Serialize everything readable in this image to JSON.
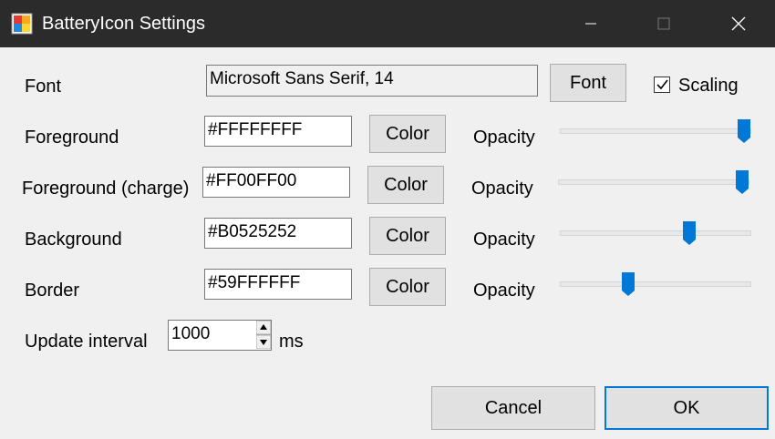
{
  "window": {
    "title": "BatteryIcon Settings"
  },
  "font_row": {
    "label": "Font",
    "value": "Microsoft Sans Serif, 14",
    "button": "Font",
    "scaling_label": "Scaling",
    "scaling_checked": true
  },
  "rows": [
    {
      "label": "Foreground",
      "value": "#FFFFFFFF",
      "button": "Color",
      "opacity_label": "Opacity",
      "opacity": 1.0
    },
    {
      "label": "Foreground (charge)",
      "value": "#FF00FF00",
      "button": "Color",
      "opacity_label": "Opacity",
      "opacity": 1.0
    },
    {
      "label": "Background",
      "value": "#B0525252",
      "button": "Color",
      "opacity_label": "Opacity",
      "opacity": 0.69
    },
    {
      "label": "Border",
      "value": "#59FFFFFF",
      "button": "Color",
      "opacity_label": "Opacity",
      "opacity": 0.35
    }
  ],
  "update_interval": {
    "label": "Update interval",
    "value": "1000",
    "unit": "ms"
  },
  "buttons": {
    "cancel": "Cancel",
    "ok": "OK"
  },
  "colors": {
    "accent": "#0078d7",
    "titlebar": "#2b2b2b"
  },
  "icons": [
    "app-icon",
    "minimize-icon",
    "maximize-icon",
    "close-icon",
    "check-icon",
    "spin-up-icon",
    "spin-down-icon"
  ]
}
